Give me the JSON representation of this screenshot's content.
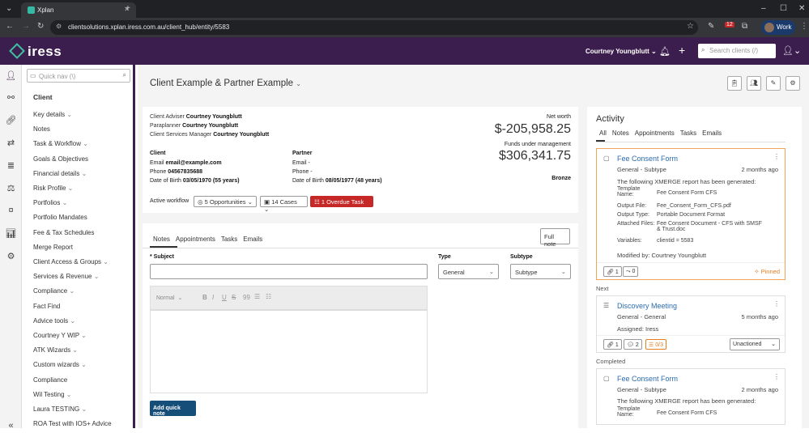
{
  "browser": {
    "tab_title": "Xplan",
    "url": "clientsolutions.xplan.iress.com.au/client_hub/entity/5583",
    "work_label": "Work",
    "notif_count": "12"
  },
  "header": {
    "logo": "iress",
    "user": "Courtney Youngblutt",
    "search_placeholder": "Search clients (/)"
  },
  "nav": {
    "quick_placeholder": "Quick nav (\\)",
    "heading": "Client",
    "items": [
      "Key details",
      "Notes",
      "Task & Workflow",
      "Goals & Objectives",
      "Financial details",
      "Risk Profile",
      "Portfolios",
      "Portfolio Mandates",
      "Fee & Tax Schedules",
      "Merge Report",
      "Client Access & Groups",
      "Services & Revenue",
      "Compliance",
      "Fact Find",
      "Advice tools",
      "Courtney Y WIP",
      "ATK Wizards",
      "Custom wizards",
      "Compliance",
      "Wil Testing",
      "Laura TESTING",
      "ROA Test with IOS+ Advice"
    ],
    "dropdown": [
      true,
      false,
      true,
      false,
      true,
      true,
      true,
      false,
      false,
      false,
      true,
      true,
      true,
      false,
      true,
      true,
      true,
      true,
      false,
      true,
      true,
      false
    ]
  },
  "page": {
    "title": "Client Example & Partner Example"
  },
  "summary": {
    "adviser_label": "Client Adviser",
    "adviser": "Courtney Youngblutt",
    "paraplanner_label": "Paraplanner",
    "paraplanner": "Courtney Youngblutt",
    "csm_label": "Client Services Manager",
    "csm": "Courtney Youngblutt",
    "client_label": "Client",
    "partner_label": "Partner",
    "email_label": "Email",
    "client_email": "email@example.com",
    "partner_email": "-",
    "phone_label": "Phone",
    "client_phone": "04567835688",
    "partner_phone": "-",
    "dob_label": "Date of Birth",
    "client_dob": "03/05/1970 (55 years)",
    "partner_dob": "08/05/1977 (48 years)",
    "net_worth_label": "Net worth",
    "net_worth": "$-205,958.25",
    "fum_label": "Funds under management",
    "fum": "$306,341.75",
    "tier": "Bronze",
    "workflow_label": "Active workflow",
    "opportunities": "5 Opportunities",
    "cases": "14 Cases",
    "overdue": "1 Overdue Task"
  },
  "notes": {
    "tabs": [
      "Notes",
      "Appointments",
      "Tasks",
      "Emails"
    ],
    "full_note": "Full note",
    "subject_label": "Subject",
    "type_label": "Type",
    "type_value": "General",
    "subtype_label": "Subtype",
    "subtype_value": "Subtype",
    "format_value": "Normal",
    "add_button": "Add quick note"
  },
  "activity": {
    "title": "Activity",
    "tabs": [
      "All",
      "Notes",
      "Appointments",
      "Tasks",
      "Emails"
    ],
    "item1": {
      "title": "Fee Consent Form",
      "sub": "General - Subtype",
      "time": "2 months ago",
      "desc": "The following XMERGE report has been generated:",
      "rows": [
        [
          "Template Name:",
          "Fee Consent Form CFS"
        ],
        [
          "Output File:",
          "Fee_Consent_Form_CFS.pdf"
        ],
        [
          "Output Type:",
          "Portable Document Format"
        ],
        [
          "Attached Files:",
          "Fee Consent Document - CFS with SMSF & Trust.doc"
        ],
        [
          "Variables:",
          "clientid = 5583"
        ]
      ],
      "modified": "Modified by: Courtney Youngblutt",
      "links": "1",
      "flows": "0",
      "pinned": "Pinned"
    },
    "next_label": "Next",
    "item2": {
      "title": "Discovery Meeting",
      "sub": "General - General",
      "time": "5 months ago",
      "assigned": "Assigned: Iress",
      "links": "1",
      "comments": "2",
      "checklist": "0/3",
      "status": "Unactioned"
    },
    "completed_label": "Completed",
    "item3": {
      "title": "Fee Consent Form",
      "sub": "General - Subtype",
      "time": "2 months ago",
      "desc": "The following XMERGE report has been generated:",
      "row_label": "Template Name:",
      "row_value": "Fee Consent Form CFS"
    }
  }
}
